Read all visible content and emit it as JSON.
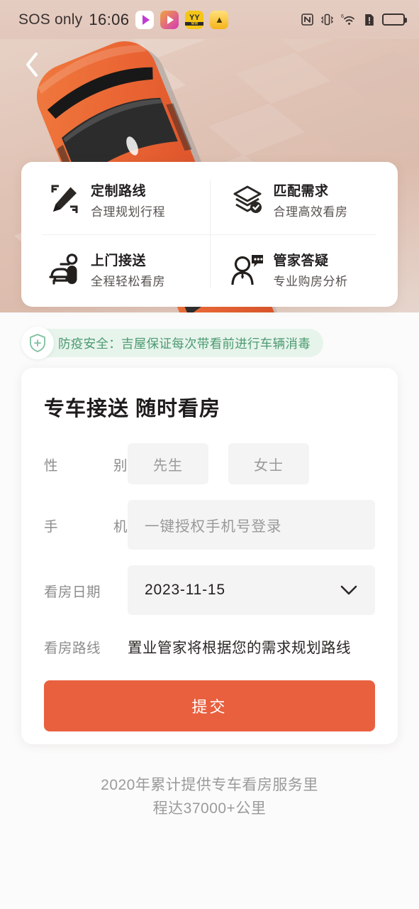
{
  "statusbar": {
    "carrier": "SOS only",
    "time": "16:06",
    "app_icons": [
      "video-play-icon",
      "video-play-icon",
      "yy-app-icon",
      "bell-app-icon"
    ],
    "right_icons": [
      "nfc-icon",
      "vibrate-icon",
      "wifi-6-icon",
      "sim-alert-icon",
      "battery-icon"
    ]
  },
  "hero": {
    "back_icon": "chevron-left-icon",
    "illustration": "orange-car-top-view",
    "bg_color": "#e0c3b5"
  },
  "features": [
    {
      "icon": "route-pencil-icon",
      "title": "定制路线",
      "subtitle": "合理规划行程"
    },
    {
      "icon": "layers-check-icon",
      "title": "匹配需求",
      "subtitle": "合理高效看房"
    },
    {
      "icon": "car-person-icon",
      "title": "上门接送",
      "subtitle": "全程轻松看房"
    },
    {
      "icon": "person-chat-icon",
      "title": "管家答疑",
      "subtitle": "专业购房分析"
    }
  ],
  "safety": {
    "icon": "shield-plus-icon",
    "text": "防疫安全：吉屋保证每次带看前进行车辆消毒",
    "color": "#4d9a70",
    "bg_color": "#e7f4ec"
  },
  "form": {
    "title": "专车接送 随时看房",
    "gender": {
      "label_a": "性",
      "label_b": "别",
      "options": [
        "先生",
        "女士"
      ]
    },
    "phone": {
      "label_a": "手",
      "label_b": "机",
      "placeholder": "一键授权手机号登录",
      "value": ""
    },
    "date": {
      "label": "看房日期",
      "value": "2023-11-15",
      "chevron_icon": "chevron-down-icon"
    },
    "route": {
      "label": "看房路线",
      "value": "置业管家将根据您的需求规划路线"
    },
    "submit_label": "提交",
    "submit_color": "#e9603f"
  },
  "footer": {
    "line1": "2020年累计提供专车看房服务里",
    "line2": "程达37000+公里"
  }
}
